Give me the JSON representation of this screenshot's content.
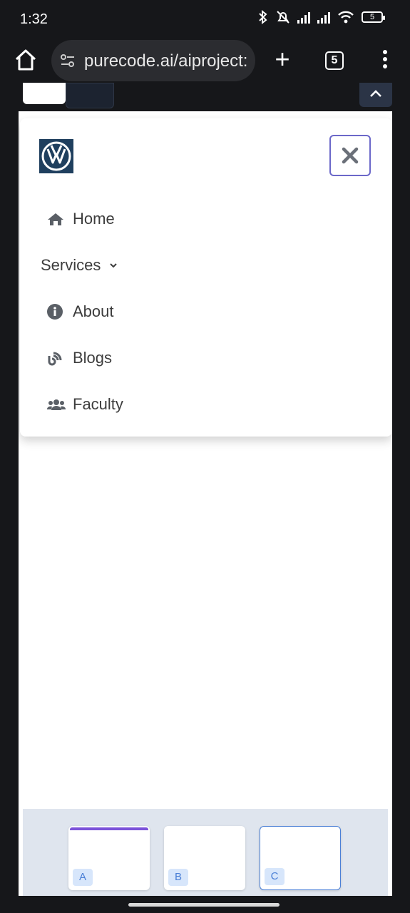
{
  "status_bar": {
    "time": "1:32",
    "battery": "5"
  },
  "browser": {
    "url": "purecode.ai/aiproject:",
    "tab_count": "5"
  },
  "nav": {
    "items": [
      {
        "label": "Home",
        "icon": "home-icon"
      },
      {
        "label": "Services",
        "icon": "chevron-down-icon"
      },
      {
        "label": "About",
        "icon": "info-icon"
      },
      {
        "label": "Blogs",
        "icon": "blog-icon"
      },
      {
        "label": "Faculty",
        "icon": "users-icon"
      }
    ]
  },
  "previews": [
    {
      "label": "A"
    },
    {
      "label": "B"
    },
    {
      "label": "C"
    }
  ],
  "colors": {
    "accent": "#6b68c9",
    "page_bg": "#ffffff",
    "chrome_bg": "#16171a",
    "preview_panel": "#dfe5ee"
  }
}
